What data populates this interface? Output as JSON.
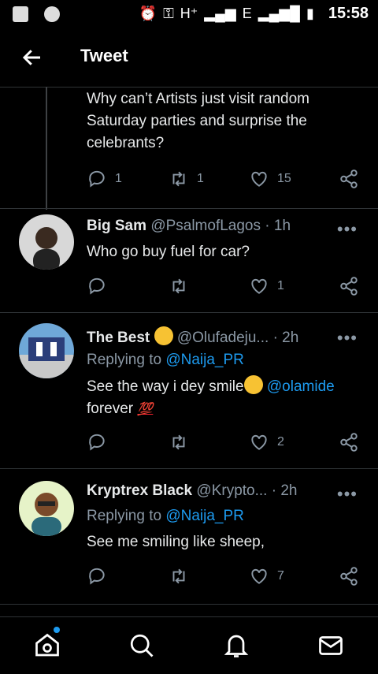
{
  "status_bar": {
    "time": "15:58",
    "network_1": "H⁺",
    "network_2": "E"
  },
  "header": {
    "title": "Tweet"
  },
  "tweets": [
    {
      "text": "Why can’t Artists just visit random Saturday parties and surprise the celebrants?",
      "replies": "1",
      "retweets": "1",
      "likes": "15"
    },
    {
      "name": "Big Sam",
      "handle": "@PsalmofLagos",
      "sep": "·",
      "time": "1h",
      "text": "Who go buy fuel for car?",
      "replies": "",
      "retweets": "",
      "likes": "1"
    },
    {
      "name": "The Best",
      "handle": "@Olufadeju...",
      "sep": "·",
      "time": "2h",
      "replying_label": "Replying to",
      "replying_to": "@Naija_PR",
      "text_start": "See the way i dey smile",
      "mention": "@olamide",
      "text_end": "forever",
      "text_emoji": "💯",
      "replies": "",
      "retweets": "",
      "likes": "2"
    },
    {
      "name": "Kryptrex Black",
      "handle": "@Krypto...",
      "sep": "·",
      "time": "2h",
      "replying_label": "Replying to",
      "replying_to": "@Naija_PR",
      "text": "See me smiling like sheep,",
      "replies": "",
      "retweets": "",
      "likes": "7"
    }
  ],
  "more_label": "•••"
}
